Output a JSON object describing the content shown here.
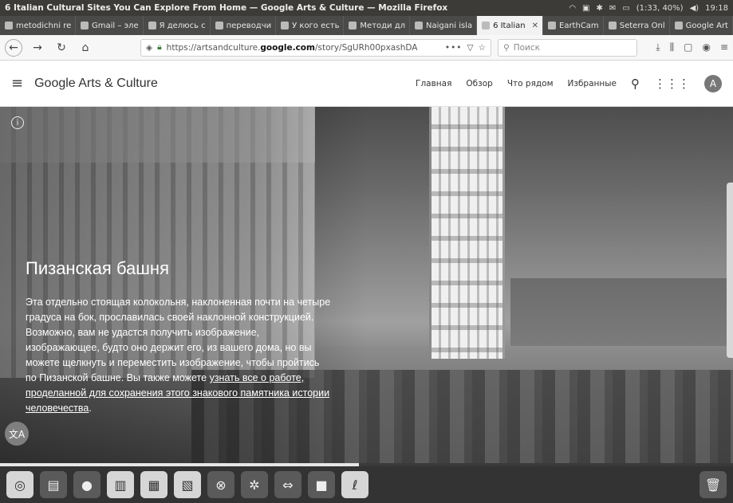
{
  "os_bar": {
    "window_title": "6 Italian Cultural Sites You Can Explore From Home — Google Arts & Culture — Mozilla Firefox",
    "status_items": [
      "(1:33, 40%)",
      "19:18"
    ]
  },
  "tabs": [
    {
      "label": "metodichni re"
    },
    {
      "label": "Gmail – эле"
    },
    {
      "label": "Я делюсь с"
    },
    {
      "label": "переводчи"
    },
    {
      "label": "У кого есть"
    },
    {
      "label": "Методи дл"
    },
    {
      "label": "Naigani isla"
    },
    {
      "label": "6 Italian",
      "active": true
    },
    {
      "label": "EarthCam"
    },
    {
      "label": "Seterra Onl"
    },
    {
      "label": "Google Art"
    }
  ],
  "navbar": {
    "url_prefix": "https://artsandculture.",
    "url_domain": "google.com",
    "url_path": "/story/SgURh00pxashDA",
    "url_more": "•••",
    "search_placeholder": "Поиск"
  },
  "site_header": {
    "logo": "Google Arts & Culture",
    "nav": [
      "Главная",
      "Обзор",
      "Что рядом",
      "Избранные"
    ],
    "avatar_letter": "A"
  },
  "hero": {
    "title": "Пизанская башня",
    "text_plain": "Эта отдельно стоящая колокольня, наклоненная почти на четыре градуса на бок, прославилась своей наклонной конструкцией. Возможно, вам не удастся получить изображение, изображающее, будто оно держит его, из вашего дома, но вы можете щелкнуть и переместить изображение, чтобы пройтись по Пизанской башне. Вы также можете ",
    "text_link": "узнать все о работе, проделанной для сохранения этого знакового памятника истории человечества",
    "text_end": ".",
    "progress": 0.49
  },
  "dock": {
    "items": [
      "ubuntu-icon",
      "files-icon",
      "firefox-icon",
      "writer-icon",
      "calc-icon",
      "impress-icon",
      "update-icon",
      "settings-icon",
      "remote-icon",
      "video-icon",
      "draw-icon"
    ],
    "trash": "trash-icon"
  }
}
